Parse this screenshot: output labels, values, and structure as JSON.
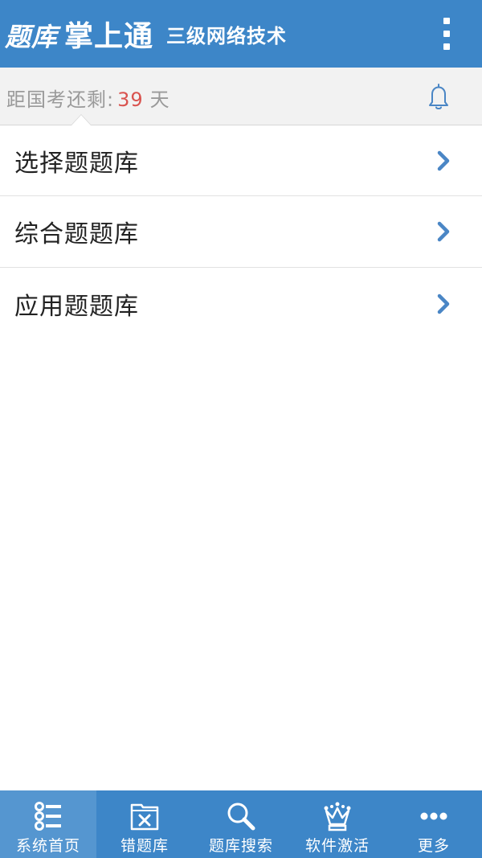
{
  "header": {
    "logo_script": "题库",
    "logo_main": "掌上通",
    "subtitle": "三级网络技术",
    "menu_icon": "more-vertical-icon"
  },
  "countdown": {
    "label": "距国考还剩:",
    "days": "39",
    "unit": "天",
    "bell_icon": "bell-icon",
    "days_color": "#d9534f"
  },
  "list": {
    "items": [
      {
        "label": "选择题题库",
        "icon": "chevron-right-icon"
      },
      {
        "label": "综合题题库",
        "icon": "chevron-right-icon"
      },
      {
        "label": "应用题题库",
        "icon": "chevron-right-icon"
      }
    ]
  },
  "bottom_nav": {
    "items": [
      {
        "label": "系统首页",
        "icon": "home-list-icon",
        "active": true
      },
      {
        "label": "错题库",
        "icon": "wrong-questions-icon",
        "active": false
      },
      {
        "label": "题库搜索",
        "icon": "search-icon",
        "active": false
      },
      {
        "label": "软件激活",
        "icon": "crown-icon",
        "active": false
      },
      {
        "label": "更多",
        "icon": "more-horizontal-icon",
        "active": false
      }
    ]
  },
  "colors": {
    "brand": "#3d86c8",
    "active_tab": "#5596d0",
    "accent_icon": "#4a86c5"
  }
}
